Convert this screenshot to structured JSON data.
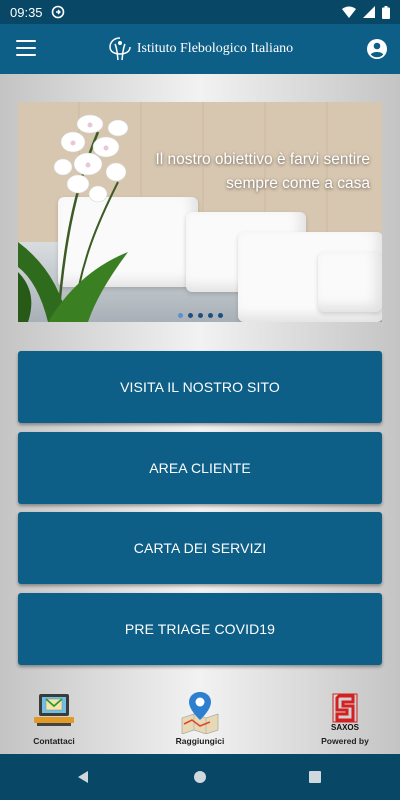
{
  "status_bar": {
    "time": "09:35"
  },
  "app_bar": {
    "title": "Istituto Flebologico Italiano"
  },
  "carousel": {
    "caption_line1": "Il nostro obiettivo è farvi sentire",
    "caption_line2": "sempre come a casa",
    "slide_count": 5,
    "active_slide": 1
  },
  "buttons": {
    "visit_site": "VISITA IL NOSTRO SITO",
    "client_area": "AREA CLIENTE",
    "service_charter": "CARTA DEI SERVIZI",
    "pre_triage": "PRE TRIAGE COVID19"
  },
  "bottom_nav": {
    "contact_label": "Contattaci",
    "reach_label": "Raggiungici",
    "powered_label": "Powered by",
    "powered_brand": "SAXOS"
  },
  "colors": {
    "primary": "#0d5f87",
    "status": "#084766"
  }
}
